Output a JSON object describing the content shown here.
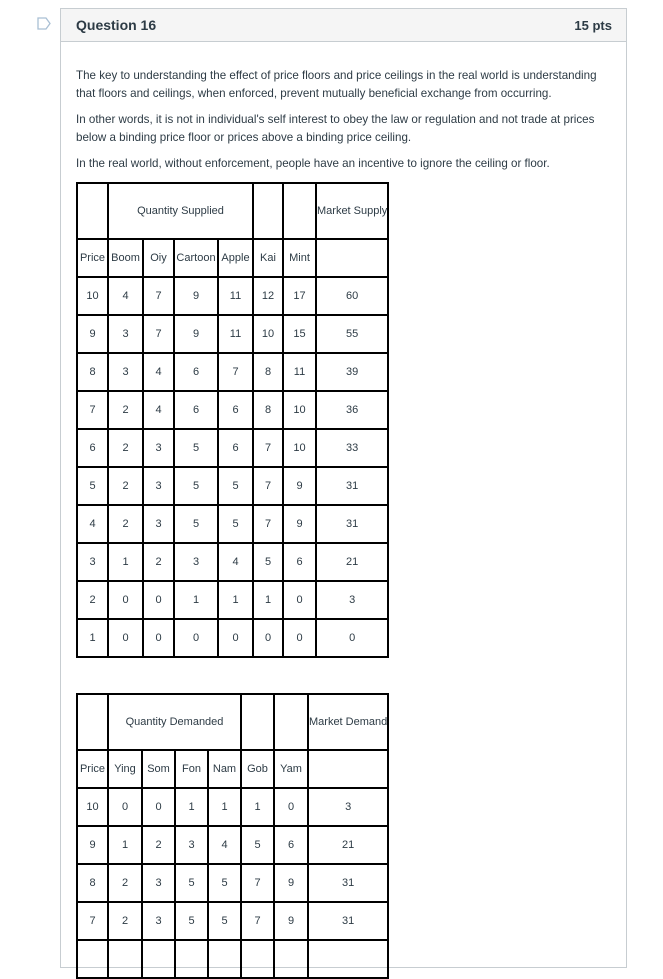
{
  "question": {
    "title": "Question 16",
    "points": "15 pts",
    "flag_icon": "bookmark-flag-icon",
    "paragraphs": [
      "The key to understanding the effect of price floors and price ceilings in the real world is understanding that floors and ceilings, when enforced, prevent mutually beneficial exchange from occurring.",
      "In other words, it is not in individual's self interest to obey the law or regulation and not trade at prices below a binding price floor or prices above a binding price ceiling.",
      "In the real world, without enforcement, people have an incentive to ignore the ceiling or floor."
    ]
  },
  "supply_table": {
    "group_label": "Quantity Supplied",
    "market_label": "Market Supply",
    "columns": [
      "Price",
      "Boom",
      "Oiy",
      "Cartoon",
      "Apple",
      "Kai",
      "Mint",
      ""
    ],
    "rows": [
      [
        "10",
        "4",
        "7",
        "9",
        "11",
        "12",
        "17",
        "60"
      ],
      [
        "9",
        "3",
        "7",
        "9",
        "11",
        "10",
        "15",
        "55"
      ],
      [
        "8",
        "3",
        "4",
        "6",
        "7",
        "8",
        "11",
        "39"
      ],
      [
        "7",
        "2",
        "4",
        "6",
        "6",
        "8",
        "10",
        "36"
      ],
      [
        "6",
        "2",
        "3",
        "5",
        "6",
        "7",
        "10",
        "33"
      ],
      [
        "5",
        "2",
        "3",
        "5",
        "5",
        "7",
        "9",
        "31"
      ],
      [
        "4",
        "2",
        "3",
        "5",
        "5",
        "7",
        "9",
        "31"
      ],
      [
        "3",
        "1",
        "2",
        "3",
        "4",
        "5",
        "6",
        "21"
      ],
      [
        "2",
        "0",
        "0",
        "1",
        "1",
        "1",
        "0",
        "3"
      ],
      [
        "1",
        "0",
        "0",
        "0",
        "0",
        "0",
        "0",
        "0"
      ]
    ]
  },
  "demand_table": {
    "group_label": "Quantity Demanded",
    "market_label": "Market Demand",
    "columns": [
      "Price",
      "Ying",
      "Som",
      "Fon",
      "Nam",
      "Gob",
      "Yam",
      ""
    ],
    "rows": [
      [
        "10",
        "0",
        "0",
        "1",
        "1",
        "1",
        "0",
        "3"
      ],
      [
        "9",
        "1",
        "2",
        "3",
        "4",
        "5",
        "6",
        "21"
      ],
      [
        "8",
        "2",
        "3",
        "5",
        "5",
        "7",
        "9",
        "31"
      ],
      [
        "7",
        "2",
        "3",
        "5",
        "5",
        "7",
        "9",
        "31"
      ],
      [
        "",
        "",
        "",
        "",
        "",
        "",
        "",
        ""
      ]
    ]
  }
}
